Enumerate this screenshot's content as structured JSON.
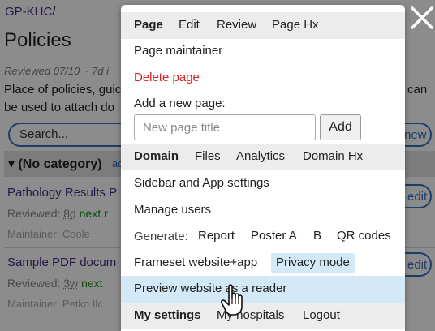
{
  "background": {
    "breadcrumb": "GP-KHC",
    "breadcrumb_sep": "/",
    "title": "Policies",
    "reviewed": "Reviewed 07/10 ~ 7d i",
    "description_line1": "Place of policies, guic",
    "description_line1_right": "can",
    "description_line2": "be used to attach do",
    "search_placeholder": "Search...",
    "new_button": "new",
    "category": {
      "name": "▾ (No category)",
      "add_label": "ac"
    },
    "items": [
      {
        "title": "Pathology Results P",
        "meta_prefix": "Reviewed: ",
        "meta_age": "8d",
        "meta_next": "next r",
        "maintainer": "Maintainer: Coole",
        "edit_label": "edit"
      },
      {
        "title": "Sample PDF docum",
        "meta_prefix": "Reviewed: ",
        "meta_age": "3w",
        "meta_next": "next",
        "maintainer": "Maintainer: Petko Ilc",
        "edit_label": "edit"
      }
    ]
  },
  "menu": {
    "page_section": {
      "header": "Page",
      "tabs": [
        "Edit",
        "Review",
        "Page Hx"
      ]
    },
    "page_maintainer": "Page maintainer",
    "delete_page": "Delete page",
    "add_new_page_label": "Add a new page:",
    "new_page_placeholder": "New page title",
    "add_button": "Add",
    "domain_section": {
      "header": "Domain",
      "tabs": [
        "Files",
        "Analytics",
        "Domain Hx"
      ]
    },
    "sidebar_settings": "Sidebar and App settings",
    "manage_users": "Manage users",
    "generate": {
      "label": "Generate:",
      "items": [
        "Report",
        "Poster A",
        "B",
        "QR codes"
      ]
    },
    "frameset": "Frameset website+app",
    "privacy_mode": "Privacy mode",
    "preview_reader": "Preview website as a reader",
    "my_settings_section": {
      "header": "My settings",
      "items": [
        "My hospitals",
        "Logout"
      ]
    }
  },
  "colors": {
    "delete": "#d42020",
    "link_purple": "#4b2a86",
    "accent_blue": "#3a6fc4",
    "highlight": "#d3e9f7",
    "section_gray": "#ececec"
  },
  "icons": [
    "close-icon",
    "hand-pointer-cursor-icon"
  ]
}
